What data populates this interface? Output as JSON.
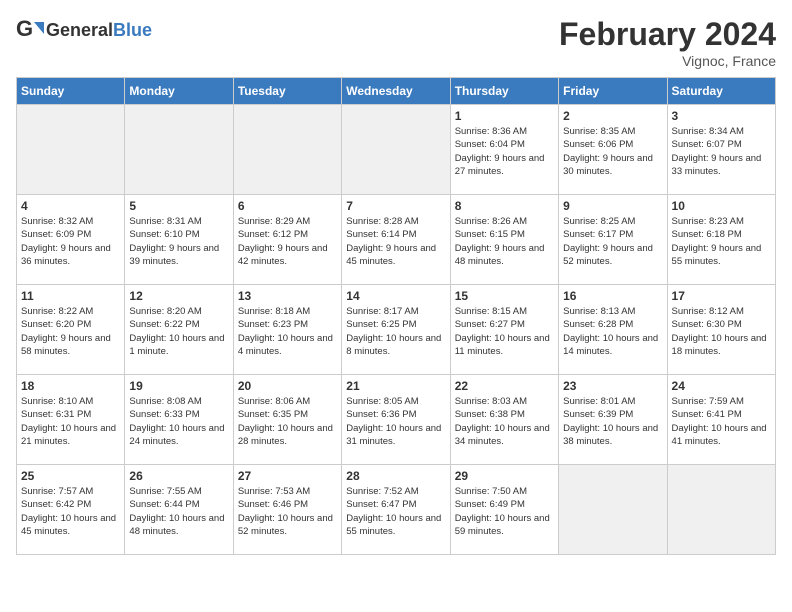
{
  "header": {
    "logo_general": "General",
    "logo_blue": "Blue",
    "month": "February 2024",
    "location": "Vignoc, France"
  },
  "weekdays": [
    "Sunday",
    "Monday",
    "Tuesday",
    "Wednesday",
    "Thursday",
    "Friday",
    "Saturday"
  ],
  "weeks": [
    [
      {
        "day": "",
        "empty": true
      },
      {
        "day": "",
        "empty": true
      },
      {
        "day": "",
        "empty": true
      },
      {
        "day": "",
        "empty": true
      },
      {
        "day": "1",
        "sunrise": "8:36 AM",
        "sunset": "6:04 PM",
        "daylight": "9 hours and 27 minutes."
      },
      {
        "day": "2",
        "sunrise": "8:35 AM",
        "sunset": "6:06 PM",
        "daylight": "9 hours and 30 minutes."
      },
      {
        "day": "3",
        "sunrise": "8:34 AM",
        "sunset": "6:07 PM",
        "daylight": "9 hours and 33 minutes."
      }
    ],
    [
      {
        "day": "4",
        "sunrise": "8:32 AM",
        "sunset": "6:09 PM",
        "daylight": "9 hours and 36 minutes."
      },
      {
        "day": "5",
        "sunrise": "8:31 AM",
        "sunset": "6:10 PM",
        "daylight": "9 hours and 39 minutes."
      },
      {
        "day": "6",
        "sunrise": "8:29 AM",
        "sunset": "6:12 PM",
        "daylight": "9 hours and 42 minutes."
      },
      {
        "day": "7",
        "sunrise": "8:28 AM",
        "sunset": "6:14 PM",
        "daylight": "9 hours and 45 minutes."
      },
      {
        "day": "8",
        "sunrise": "8:26 AM",
        "sunset": "6:15 PM",
        "daylight": "9 hours and 48 minutes."
      },
      {
        "day": "9",
        "sunrise": "8:25 AM",
        "sunset": "6:17 PM",
        "daylight": "9 hours and 52 minutes."
      },
      {
        "day": "10",
        "sunrise": "8:23 AM",
        "sunset": "6:18 PM",
        "daylight": "9 hours and 55 minutes."
      }
    ],
    [
      {
        "day": "11",
        "sunrise": "8:22 AM",
        "sunset": "6:20 PM",
        "daylight": "9 hours and 58 minutes."
      },
      {
        "day": "12",
        "sunrise": "8:20 AM",
        "sunset": "6:22 PM",
        "daylight": "10 hours and 1 minute."
      },
      {
        "day": "13",
        "sunrise": "8:18 AM",
        "sunset": "6:23 PM",
        "daylight": "10 hours and 4 minutes."
      },
      {
        "day": "14",
        "sunrise": "8:17 AM",
        "sunset": "6:25 PM",
        "daylight": "10 hours and 8 minutes."
      },
      {
        "day": "15",
        "sunrise": "8:15 AM",
        "sunset": "6:27 PM",
        "daylight": "10 hours and 11 minutes."
      },
      {
        "day": "16",
        "sunrise": "8:13 AM",
        "sunset": "6:28 PM",
        "daylight": "10 hours and 14 minutes."
      },
      {
        "day": "17",
        "sunrise": "8:12 AM",
        "sunset": "6:30 PM",
        "daylight": "10 hours and 18 minutes."
      }
    ],
    [
      {
        "day": "18",
        "sunrise": "8:10 AM",
        "sunset": "6:31 PM",
        "daylight": "10 hours and 21 minutes."
      },
      {
        "day": "19",
        "sunrise": "8:08 AM",
        "sunset": "6:33 PM",
        "daylight": "10 hours and 24 minutes."
      },
      {
        "day": "20",
        "sunrise": "8:06 AM",
        "sunset": "6:35 PM",
        "daylight": "10 hours and 28 minutes."
      },
      {
        "day": "21",
        "sunrise": "8:05 AM",
        "sunset": "6:36 PM",
        "daylight": "10 hours and 31 minutes."
      },
      {
        "day": "22",
        "sunrise": "8:03 AM",
        "sunset": "6:38 PM",
        "daylight": "10 hours and 34 minutes."
      },
      {
        "day": "23",
        "sunrise": "8:01 AM",
        "sunset": "6:39 PM",
        "daylight": "10 hours and 38 minutes."
      },
      {
        "day": "24",
        "sunrise": "7:59 AM",
        "sunset": "6:41 PM",
        "daylight": "10 hours and 41 minutes."
      }
    ],
    [
      {
        "day": "25",
        "sunrise": "7:57 AM",
        "sunset": "6:42 PM",
        "daylight": "10 hours and 45 minutes."
      },
      {
        "day": "26",
        "sunrise": "7:55 AM",
        "sunset": "6:44 PM",
        "daylight": "10 hours and 48 minutes."
      },
      {
        "day": "27",
        "sunrise": "7:53 AM",
        "sunset": "6:46 PM",
        "daylight": "10 hours and 52 minutes."
      },
      {
        "day": "28",
        "sunrise": "7:52 AM",
        "sunset": "6:47 PM",
        "daylight": "10 hours and 55 minutes."
      },
      {
        "day": "29",
        "sunrise": "7:50 AM",
        "sunset": "6:49 PM",
        "daylight": "10 hours and 59 minutes."
      },
      {
        "day": "",
        "empty": true
      },
      {
        "day": "",
        "empty": true
      }
    ]
  ],
  "labels": {
    "sunrise": "Sunrise:",
    "sunset": "Sunset:",
    "daylight": "Daylight:"
  }
}
